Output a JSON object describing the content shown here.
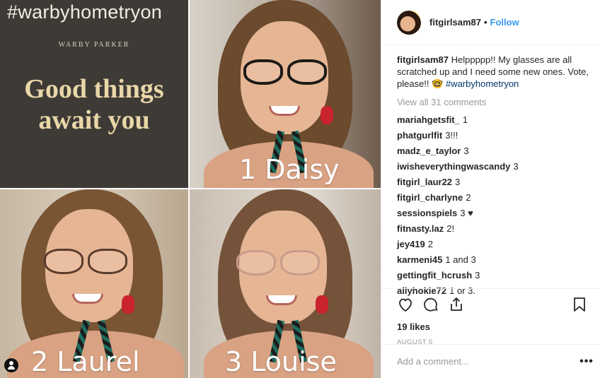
{
  "media": {
    "hashtag": "#warbyhometryon",
    "brand": "WARBY PARKER",
    "tagline_line1": "Good things",
    "tagline_line2": "await you",
    "labels": [
      "1 Daisy",
      "2 Laurel",
      "3 Louise"
    ]
  },
  "header": {
    "username": "fitgirlsam87",
    "separator": "•",
    "follow_label": "Follow"
  },
  "caption": {
    "username": "fitgirlsam87",
    "text": " Helppppp!! My glasses are all scratched up and I need some new ones. Vote, please!! 🤓 ",
    "hashtag": "#warbyhometryon"
  },
  "view_all": "View all 31 comments",
  "comments": [
    {
      "user": "mariahgetsfit_",
      "text": "1"
    },
    {
      "user": "phatgurlfit",
      "text": "3!!!"
    },
    {
      "user": "madz_e_taylor",
      "text": "3"
    },
    {
      "user": "iwisheverythingwascandy",
      "text": "3"
    },
    {
      "user": "fitgirl_laur22",
      "text": "3"
    },
    {
      "user": "fitgirl_charlyne",
      "text": "2"
    },
    {
      "user": "sessionspiels",
      "text": "3 ♥"
    },
    {
      "user": "fitnasty.laz",
      "text": "2!"
    },
    {
      "user": "jey419",
      "text": "2"
    },
    {
      "user": "karmeni45",
      "text": "1 and 3"
    },
    {
      "user": "gettingfit_hcrush",
      "text": "3"
    },
    {
      "user": "allyhokie72",
      "text": "1 or 3."
    }
  ],
  "likes": "19 likes",
  "date": "AUGUST 5",
  "add_comment_placeholder": "Add a comment...",
  "more_label": "•••",
  "colors": {
    "link": "#3897f0",
    "hashtag": "#003569",
    "muted": "#999999"
  },
  "icons": [
    "heart-icon",
    "comment-icon",
    "share-icon",
    "bookmark-icon",
    "user-tag-icon"
  ]
}
